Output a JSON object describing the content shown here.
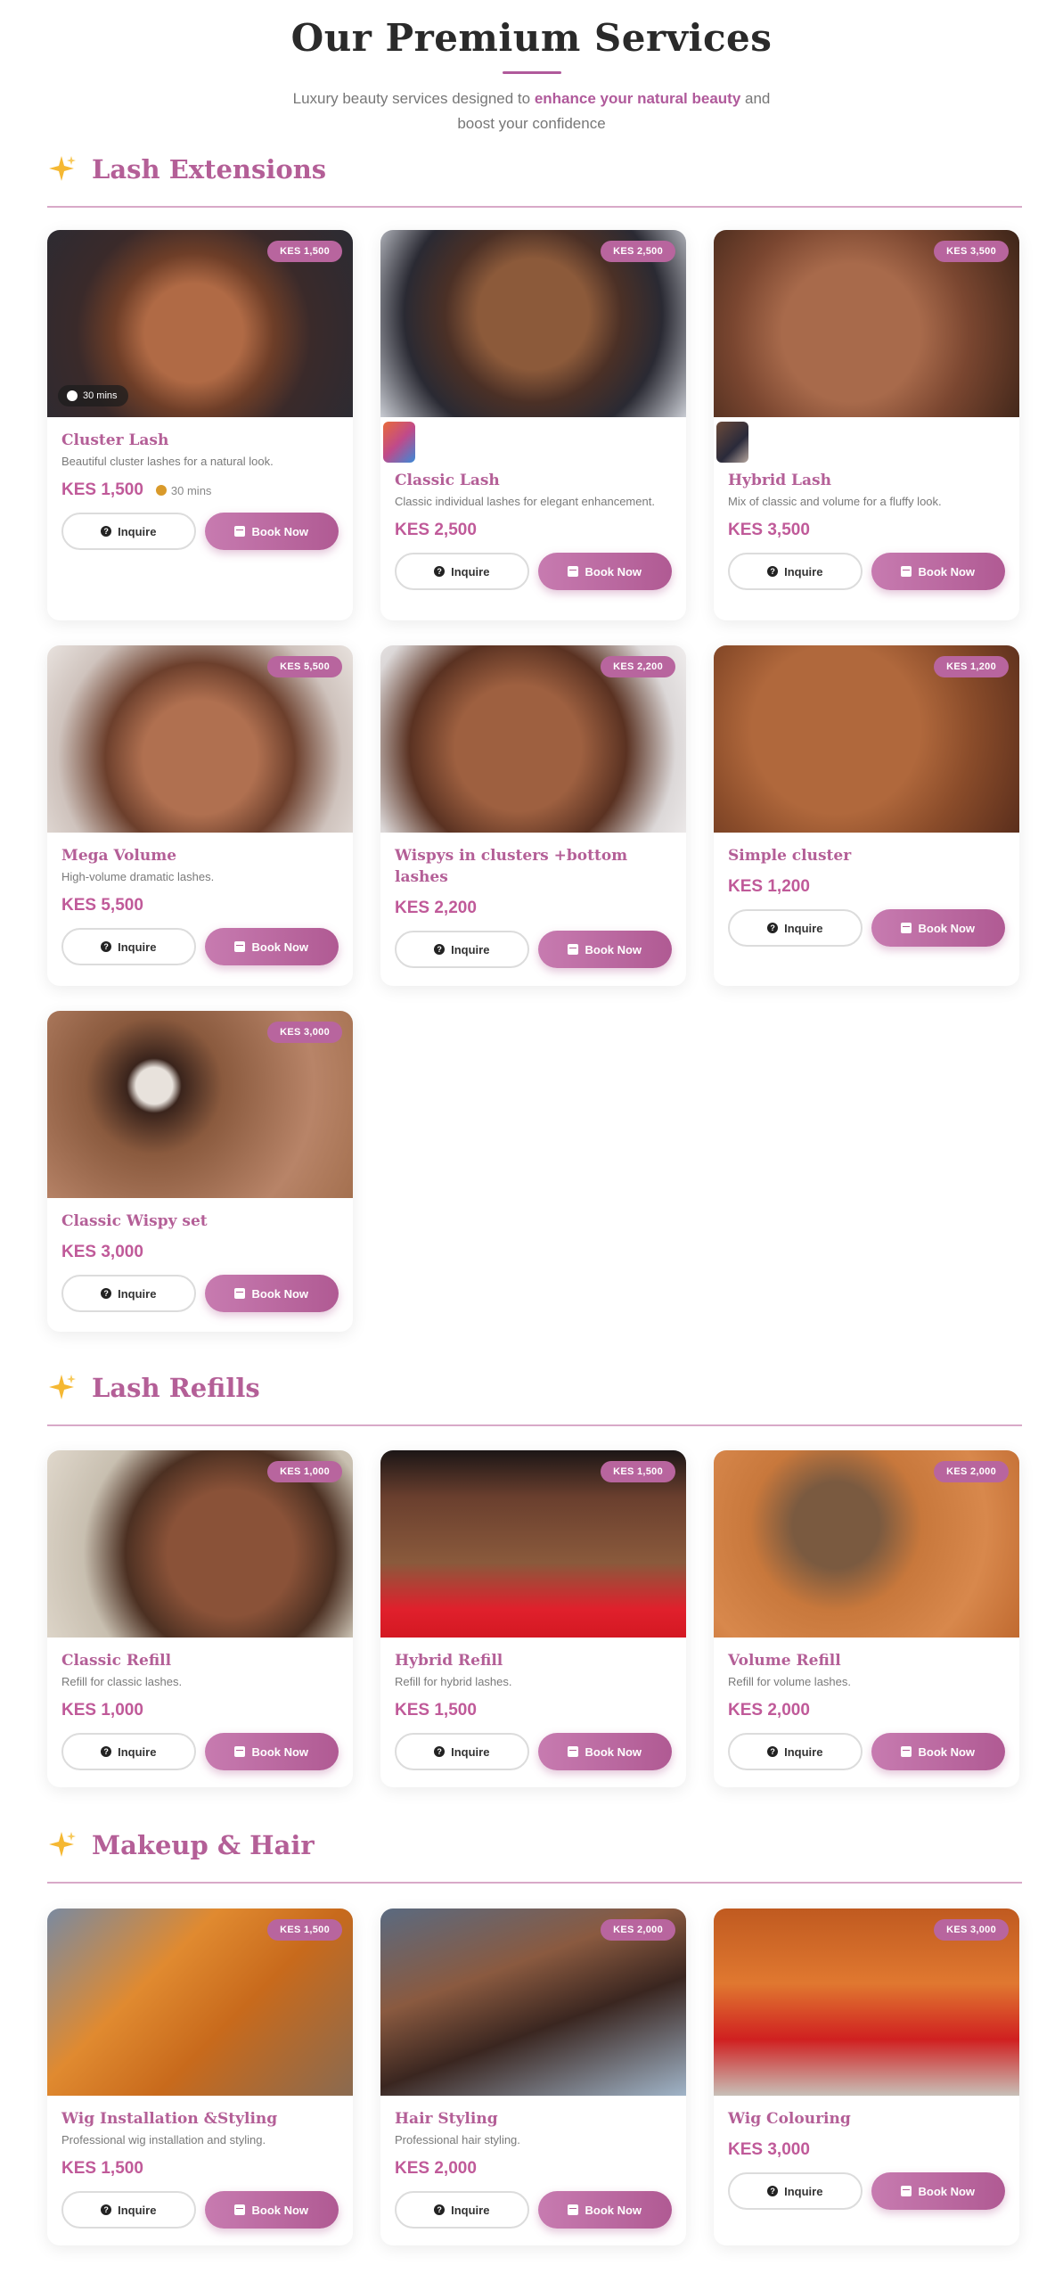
{
  "hero": {
    "title": "Our Premium Services",
    "subtitle_pre": "Luxury beauty services designed to ",
    "subtitle_bold": "enhance your natural beauty",
    "subtitle_post": " and boost your confidence"
  },
  "buttons": {
    "inquire": "Inquire",
    "book": "Book Now"
  },
  "sections": [
    {
      "title": "Lash Extensions",
      "cards": [
        {
          "title": "Cluster Lash",
          "desc": "Beautiful cluster lashes for a natural look.",
          "price": "KES 1,500",
          "badge": "KES 1,500",
          "duration": "30 mins"
        },
        {
          "title": "Classic Lash",
          "desc": "Classic individual lashes for elegant enhancement.",
          "price": "KES 2,500",
          "badge": "KES 2,500"
        },
        {
          "title": "Hybrid Lash",
          "desc": "Mix of classic and volume for a fluffy look.",
          "price": "KES 3,500",
          "badge": "KES 3,500"
        },
        {
          "title": "Mega Volume",
          "desc": "High-volume dramatic lashes.",
          "price": "KES 5,500",
          "badge": "KES 5,500"
        },
        {
          "title": "Wispys in clusters +bottom lashes",
          "desc": "",
          "price": "KES 2,200",
          "badge": "KES 2,200"
        },
        {
          "title": "Simple cluster",
          "desc": "",
          "price": "KES 1,200",
          "badge": "KES 1,200"
        },
        {
          "title": "Classic Wispy set",
          "desc": "",
          "price": "KES 3,000",
          "badge": "KES 3,000"
        }
      ]
    },
    {
      "title": "Lash Refills",
      "cards": [
        {
          "title": "Classic Refill",
          "desc": "Refill for classic lashes.",
          "price": "KES 1,000",
          "badge": "KES 1,000"
        },
        {
          "title": "Hybrid Refill",
          "desc": "Refill for hybrid lashes.",
          "price": "KES 1,500",
          "badge": "KES 1,500"
        },
        {
          "title": "Volume Refill",
          "desc": "Refill for volume lashes.",
          "price": "KES 2,000",
          "badge": "KES 2,000"
        }
      ]
    },
    {
      "title": "Makeup & Hair",
      "cards": [
        {
          "title": "Wig Installation &Styling",
          "desc": "Professional wig installation and styling.",
          "price": "KES 1,500",
          "badge": "KES 1,500"
        },
        {
          "title": "Hair Styling",
          "desc": "Professional hair styling.",
          "price": "KES 2,000",
          "badge": "KES 2,000"
        },
        {
          "title": "Wig Colouring",
          "desc": "",
          "price": "KES 3,000",
          "badge": "KES 3,000"
        }
      ]
    }
  ],
  "colors": {
    "accent": "#b45f97",
    "badge": "#b8659e",
    "rule": "#d8a9c8"
  },
  "icons": {
    "sparkle": "sparkles-icon",
    "inquire": "question-circle-icon",
    "book": "calendar-icon",
    "duration": "clock-icon"
  }
}
